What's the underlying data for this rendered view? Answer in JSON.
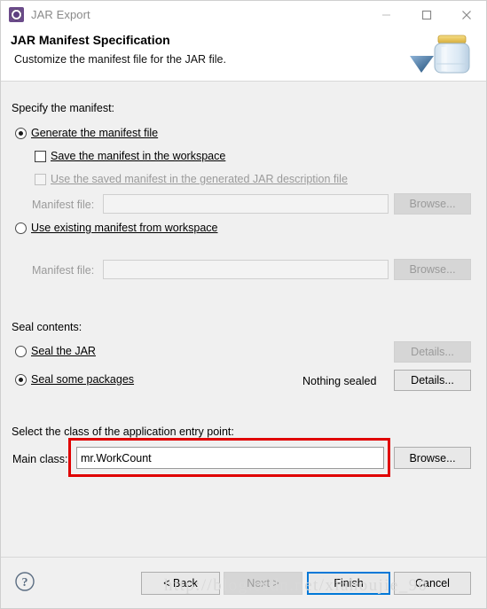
{
  "window": {
    "title": "JAR Export",
    "icon": "jar-export-cog-icon",
    "controls": {
      "minimize": "minimize-icon",
      "maximize": "maximize-icon",
      "close": "close-icon"
    }
  },
  "header": {
    "title": "JAR Manifest Specification",
    "subtitle": "Customize the manifest file for the JAR file.",
    "art": "jar-bottle-icon"
  },
  "manifest_section": {
    "label": "Specify the manifest:",
    "generate_radio": "Generate the manifest file",
    "save_checkbox": "Save the manifest in the workspace",
    "use_saved_checkbox": "Use the saved manifest in the generated JAR description file",
    "manifest_file_label_1": "Manifest file:",
    "manifest_file_value_1": "",
    "browse_1": "Browse...",
    "use_existing_radio": "Use existing manifest from workspace",
    "manifest_file_label_2": "Manifest file:",
    "manifest_file_value_2": "",
    "browse_2": "Browse..."
  },
  "seal_section": {
    "label": "Seal contents:",
    "seal_jar_radio": "Seal the JAR",
    "seal_jar_details": "Details...",
    "seal_some_radio": "Seal some packages",
    "seal_status": "Nothing sealed",
    "seal_some_details": "Details..."
  },
  "entry_point_section": {
    "label": "Select the class of the application entry point:",
    "main_class_label": "Main class:",
    "main_class_value": "mr.WorkCount",
    "browse": "Browse..."
  },
  "footer": {
    "help": "help-icon",
    "back": "< Back",
    "next": "Next >",
    "finish": "Finish",
    "cancel": "Cancel"
  },
  "watermark": "http://blog.csdn.net/xiahoujie_90",
  "colors": {
    "accent": "#0078d7",
    "annotation": "#e00000",
    "body_bg": "#f0f0f0",
    "header_bg": "#ffffff",
    "disabled_text": "#9a9a9a"
  }
}
